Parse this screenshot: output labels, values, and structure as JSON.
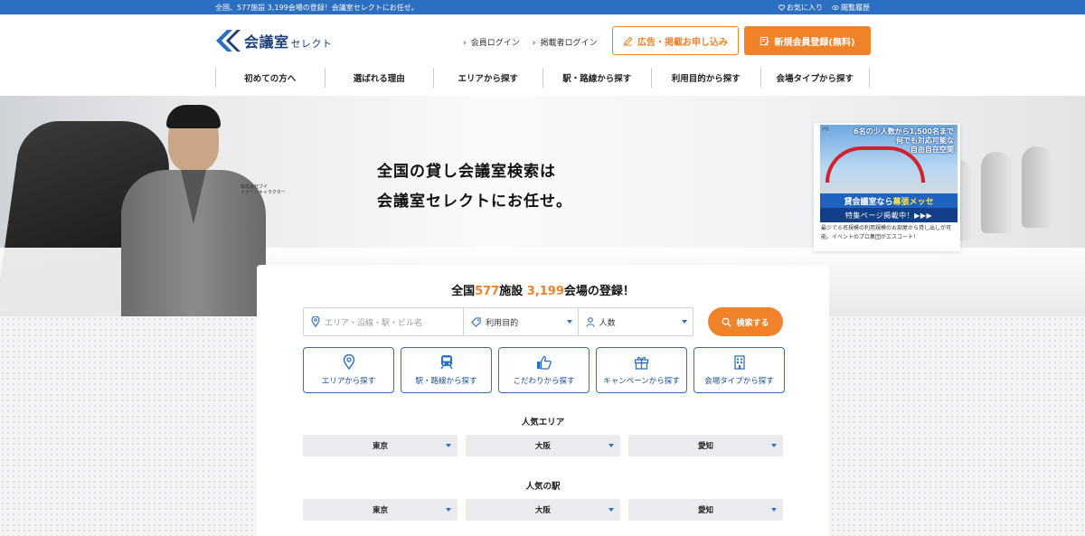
{
  "topbar": {
    "text": "全国、577施設 3,199会場の登録！会議室セレクトにお任せ。",
    "favorites": "お気に入り",
    "history": "閲覧履歴"
  },
  "header": {
    "logo_main": "会議室",
    "logo_sub": "セレクト",
    "member_login": "会員ログイン",
    "publisher_login": "掲載者ログイン",
    "ad_button": "広告・掲載お申し込み",
    "register_button": "新規会員登録(無料)"
  },
  "nav": {
    "items": [
      "初めての方へ",
      "選ばれる理由",
      "エリアから探す",
      "駅・路線から探す",
      "利用目的から探す",
      "会場タイプから探す"
    ]
  },
  "hero": {
    "title_line1": "全国の貸し会議室検索は",
    "title_line2": "会議室セレクトにお任せ。",
    "caption_line1": "株式会社ブイ",
    "caption_line2": "イメージキャラクター"
  },
  "pr": {
    "tag": "PR",
    "copy_line1": "6名の少人数から1,500名まで",
    "copy_line2": "何でも対応可能な",
    "copy_line3": "自由自在空間",
    "band_pre": "貸会議室なら",
    "band_main": "幕張メッセ",
    "band2": "特集ページ掲載中！▶▶▶",
    "desc": "最少で６名規模の利用規模のお部屋から貸し出しが可能。イベントのプロ集団がエスコート！"
  },
  "search": {
    "count_pre": "全国",
    "count_facilities": "577",
    "count_mid": "施設",
    "count_venues": "3,199",
    "count_post": "会場の登録！",
    "place_placeholder": "エリア・沿線・駅・ビル名",
    "purpose_label": "利用目的",
    "people_label": "人数",
    "search_button": "検索する"
  },
  "categories": [
    {
      "label": "エリアから探す",
      "icon": "map-pin-icon"
    },
    {
      "label": "駅・路線から探す",
      "icon": "train-icon"
    },
    {
      "label": "こだわりから探す",
      "icon": "thumbs-up-icon"
    },
    {
      "label": "キャンペーンから探す",
      "icon": "gift-icon"
    },
    {
      "label": "会場タイプから探す",
      "icon": "building-icon"
    }
  ],
  "popular_area": {
    "title": "人気エリア",
    "options": [
      "東京",
      "大阪",
      "愛知"
    ]
  },
  "popular_station": {
    "title": "人気の駅",
    "options": [
      "東京",
      "大阪",
      "愛知"
    ]
  },
  "colors": {
    "brand_blue": "#2b6fc2",
    "accent_orange": "#f0822a",
    "logo_navy": "#1d3f7a"
  }
}
